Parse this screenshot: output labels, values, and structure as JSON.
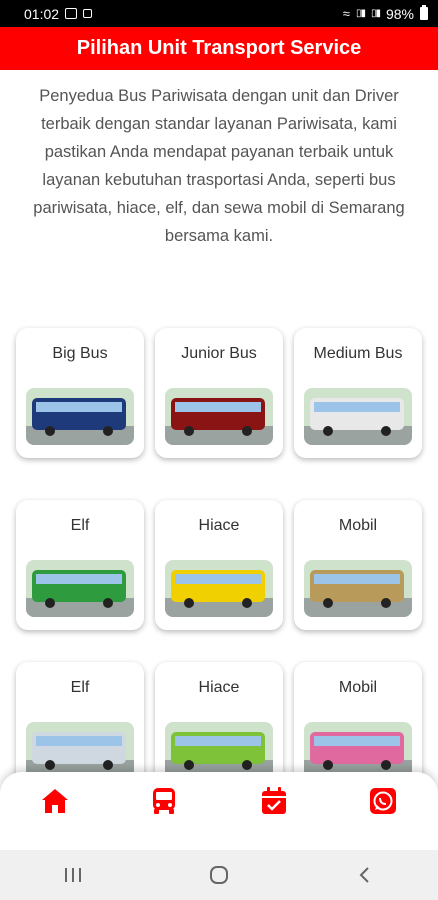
{
  "status_bar": {
    "time": "01:02",
    "battery": "98%",
    "signal_1": "VoLTE",
    "signal_2": "VoLTE"
  },
  "header": {
    "title": "Pilihan Unit Transport Service"
  },
  "intro_text": "Penyedua Bus Pariwisata dengan unit dan Driver terbaik dengan standar layanan Pariwisata, kami pastikan Anda mendapat payanan terbaik untuk layanan kebutuhan trasportasi Anda, seperti bus pariwisata, hiace, elf, dan sewa mobil di Semarang bersama kami.",
  "units": [
    {
      "title": "Big Bus",
      "color": "#1e3a7a"
    },
    {
      "title": "Junior Bus",
      "color": "#8a1414"
    },
    {
      "title": "Medium Bus",
      "color": "#e8e8e8"
    },
    {
      "title": "Elf",
      "color": "#2e9b3e"
    },
    {
      "title": "Hiace",
      "color": "#f0d000"
    },
    {
      "title": "Mobil",
      "color": "#b89a5a"
    },
    {
      "title": "Elf",
      "color": "#cfd8e0"
    },
    {
      "title": "Hiace",
      "color": "#7ec23a"
    },
    {
      "title": "Mobil",
      "color": "#e06aa0"
    }
  ],
  "bottom_nav": [
    {
      "icon": "home-icon"
    },
    {
      "icon": "bus-icon"
    },
    {
      "icon": "calendar-check-icon"
    },
    {
      "icon": "whatsapp-icon"
    }
  ],
  "colors": {
    "accent": "#ff0000"
  }
}
